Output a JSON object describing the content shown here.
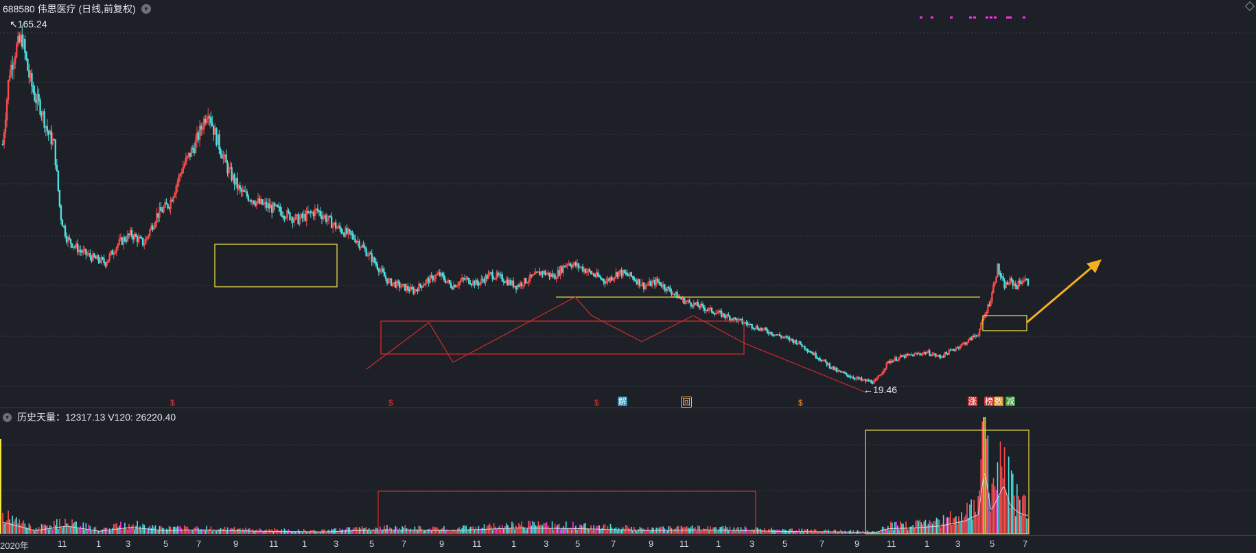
{
  "header": {
    "title": "688580 伟思医疗 (日线,前复权)",
    "chevron": "▾"
  },
  "volume_header": {
    "label": "历史天量：12317.13 V120: 26220.40",
    "chevron": "▾"
  },
  "price_labels": {
    "high": "165.24",
    "low": "19.46"
  },
  "markers": [
    {
      "name": "marker-s-1",
      "text": "$",
      "color": "#e8312f",
      "bg": ""
    },
    {
      "name": "marker-s-2",
      "text": "$",
      "color": "#e8312f",
      "bg": ""
    },
    {
      "name": "marker-s-3",
      "text": "$",
      "color": "#e8312f",
      "bg": ""
    },
    {
      "name": "marker-jie",
      "text": "解",
      "color": "#ffffff",
      "bg": "#2a8fb0"
    },
    {
      "name": "marker-hui",
      "text": "回",
      "color": "#f3b36b",
      "bg": ""
    },
    {
      "name": "marker-s-4",
      "text": "$",
      "color": "#f08a30",
      "bg": ""
    },
    {
      "name": "marker-zhang",
      "text": "涨",
      "color": "#ffffff",
      "bg": "#c8322e"
    },
    {
      "name": "marker-bang",
      "text": "榜",
      "color": "#ffffff",
      "bg": "#c8322e"
    },
    {
      "name": "marker-shu",
      "text": "数",
      "color": "#ffffff",
      "bg": "#d98a2a"
    },
    {
      "name": "marker-jian",
      "text": "减",
      "color": "#ffffff",
      "bg": "#3a9a3a"
    }
  ],
  "colors": {
    "up": "#ff4d4d",
    "down": "#4de0e0",
    "box_yellow": "#e6d84a",
    "box_red": "#d42b2b",
    "arrow": "#f5b020",
    "volume_magenta": "#ff2ef0",
    "volume_yellow": "#f3e83a",
    "grid": "#3a3d47"
  },
  "chart_data": {
    "type": "candlestick",
    "title": "688580 伟思医疗 (日线,前复权)",
    "y_high_label": 165.24,
    "y_low_label": 19.46,
    "x_ticks": [
      "2020年",
      "11",
      "1",
      "3",
      "5",
      "7",
      "9",
      "11",
      "1",
      "3",
      "5",
      "7",
      "9",
      "11",
      "1",
      "3",
      "5",
      "7",
      "9",
      "11",
      "1",
      "3",
      "5",
      "7",
      "9",
      "11",
      "1",
      "3",
      "5",
      "7"
    ],
    "price_path": [
      [
        0,
        120
      ],
      [
        1,
        150
      ],
      [
        2,
        160
      ],
      [
        3,
        165
      ],
      [
        4,
        150
      ],
      [
        5,
        140
      ],
      [
        6,
        135
      ],
      [
        7,
        125
      ],
      [
        8,
        120
      ],
      [
        9,
        90
      ],
      [
        10,
        80
      ],
      [
        12,
        75
      ],
      [
        14,
        72
      ],
      [
        16,
        70
      ],
      [
        18,
        78
      ],
      [
        20,
        82
      ],
      [
        22,
        78
      ],
      [
        24,
        90
      ],
      [
        26,
        95
      ],
      [
        28,
        110
      ],
      [
        30,
        120
      ],
      [
        32,
        135
      ],
      [
        33,
        125
      ],
      [
        35,
        110
      ],
      [
        37,
        100
      ],
      [
        40,
        95
      ],
      [
        43,
        92
      ],
      [
        46,
        88
      ],
      [
        49,
        92
      ],
      [
        52,
        85
      ],
      [
        55,
        80
      ],
      [
        58,
        70
      ],
      [
        60,
        62
      ],
      [
        62,
        60
      ],
      [
        64,
        58
      ],
      [
        66,
        62
      ],
      [
        68,
        65
      ],
      [
        70,
        60
      ],
      [
        72,
        63
      ],
      [
        74,
        61
      ],
      [
        76,
        65
      ],
      [
        78,
        63
      ],
      [
        80,
        60
      ],
      [
        82,
        63
      ],
      [
        84,
        66
      ],
      [
        86,
        64
      ],
      [
        88,
        70
      ],
      [
        90,
        68
      ],
      [
        92,
        65
      ],
      [
        94,
        62
      ],
      [
        96,
        66
      ],
      [
        98,
        64
      ],
      [
        100,
        60
      ],
      [
        102,
        62
      ],
      [
        104,
        58
      ],
      [
        106,
        54
      ],
      [
        108,
        52
      ],
      [
        110,
        50
      ],
      [
        112,
        48
      ],
      [
        114,
        46
      ],
      [
        116,
        44
      ],
      [
        118,
        42
      ],
      [
        120,
        40
      ],
      [
        122,
        38
      ],
      [
        124,
        36
      ],
      [
        126,
        32
      ],
      [
        128,
        28
      ],
      [
        130,
        24
      ],
      [
        132,
        22
      ],
      [
        134,
        20
      ],
      [
        136,
        19.5
      ],
      [
        138,
        28
      ],
      [
        140,
        30
      ],
      [
        142,
        31
      ],
      [
        144,
        32
      ],
      [
        146,
        30
      ],
      [
        148,
        33
      ],
      [
        150,
        36
      ],
      [
        152,
        40
      ],
      [
        154,
        55
      ],
      [
        155,
        68
      ],
      [
        156,
        60
      ],
      [
        157,
        62
      ],
      [
        158,
        60
      ],
      [
        159,
        63
      ],
      [
        160,
        61
      ]
    ],
    "volume_profile": [
      [
        0,
        0.18
      ],
      [
        5,
        0.05
      ],
      [
        10,
        0.12
      ],
      [
        15,
        0.04
      ],
      [
        20,
        0.1
      ],
      [
        25,
        0.05
      ],
      [
        30,
        0.06
      ],
      [
        40,
        0.04
      ],
      [
        50,
        0.03
      ],
      [
        55,
        0.05
      ],
      [
        60,
        0.06
      ],
      [
        70,
        0.05
      ],
      [
        80,
        0.09
      ],
      [
        90,
        0.08
      ],
      [
        100,
        0.05
      ],
      [
        110,
        0.06
      ],
      [
        120,
        0.04
      ],
      [
        130,
        0.03
      ],
      [
        136,
        0.02
      ],
      [
        138,
        0.08
      ],
      [
        142,
        0.09
      ],
      [
        146,
        0.12
      ],
      [
        150,
        0.2
      ],
      [
        152,
        0.3
      ],
      [
        153,
        1.0
      ],
      [
        154,
        0.35
      ],
      [
        155,
        0.55
      ],
      [
        156,
        0.75
      ],
      [
        157,
        0.45
      ],
      [
        158,
        0.35
      ],
      [
        159,
        0.3
      ],
      [
        160,
        0.28
      ]
    ]
  }
}
